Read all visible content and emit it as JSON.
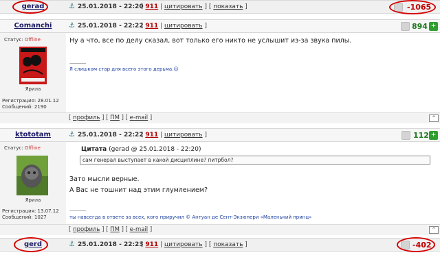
{
  "posts": [
    {
      "user": "gerad",
      "date": "25.01.2018 - 22:20",
      "num": "911",
      "quote_label": "цитировать",
      "show_label": "показать",
      "rating": "-1065"
    },
    {
      "user": "Comanchi",
      "date": "25.01.2018 - 22:22",
      "num": "911",
      "quote_label": "цитировать",
      "rating": "894",
      "status_label": "Статус:",
      "status_value": "Offline",
      "avatar_caption": "Ярила",
      "reg_label": "Регистрация: 28.01.12",
      "msg_label": "Сообщений: 2190",
      "text": "Ну а что, все по делу сказал, вот только его никто не услышит из-за звука пилы.",
      "separator": "--------------------",
      "signature": "Я слишком стар для всего этого дерьма.☺",
      "footer": {
        "profile": "профиль",
        "pm": "ПМ",
        "email": "e-mail",
        "up": "^"
      }
    },
    {
      "user": "ktototam",
      "date": "25.01.2018 - 22:22",
      "num": "911",
      "quote_label": "цитировать",
      "rating": "112",
      "status_label": "Статус:",
      "status_value": "Offline",
      "avatar_caption": "Ярила",
      "reg_label": "Регистрация: 13.07.12",
      "msg_label": "Сообщений: 1027",
      "quote_head_bold": "Цитата",
      "quote_head_rest": "(gerad @ 25.01.2018 - 22:20)",
      "quote_text": "сам генерал выступает в какой дисциплине? питрбол?",
      "text1": "Зато мысли верные.",
      "text2": "А Вас не тошнит над этим глумлением?",
      "separator": "--------------------",
      "signature": "ты навсегда в ответе за всех, кого приручил © Антуан де Сент-Экзюпери «Маленький принц»",
      "footer": {
        "profile": "профиль",
        "pm": "ПМ",
        "email": "e-mail",
        "up": "^"
      }
    },
    {
      "user": "gerd",
      "date": "25.01.2018 - 22:23",
      "num": "911",
      "quote_label": "цитировать",
      "show_label": "показать",
      "rating": "-402"
    }
  ],
  "colors": {
    "highlight": "#d40000",
    "negative": "#c00000",
    "positive": "#1e7a1e"
  }
}
